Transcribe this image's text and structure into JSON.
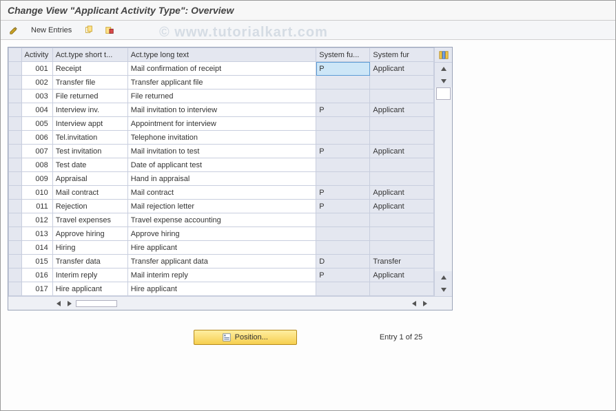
{
  "title": "Change View \"Applicant Activity Type\": Overview",
  "watermark": "© www.tutorialkart.com",
  "toolbar": {
    "new_entries_label": "New Entries"
  },
  "columns": {
    "activity": "Activity",
    "short": "Act.type short t...",
    "long": "Act.type long text",
    "sf1": "System fu...",
    "sf2": "System fur"
  },
  "rows": [
    {
      "act": "001",
      "short": "Receipt",
      "long": "Mail confirmation of receipt",
      "sf1": "P",
      "sf2": "Applicant"
    },
    {
      "act": "002",
      "short": "Transfer file",
      "long": "Transfer applicant file",
      "sf1": "",
      "sf2": ""
    },
    {
      "act": "003",
      "short": "File returned",
      "long": "File returned",
      "sf1": "",
      "sf2": ""
    },
    {
      "act": "004",
      "short": "Interview inv.",
      "long": "Mail invitation to interview",
      "sf1": "P",
      "sf2": "Applicant"
    },
    {
      "act": "005",
      "short": "Interview appt",
      "long": "Appointment for interview",
      "sf1": "",
      "sf2": ""
    },
    {
      "act": "006",
      "short": "Tel.invitation",
      "long": "Telephone invitation",
      "sf1": "",
      "sf2": ""
    },
    {
      "act": "007",
      "short": "Test invitation",
      "long": "Mail invitation to test",
      "sf1": "P",
      "sf2": "Applicant"
    },
    {
      "act": "008",
      "short": "Test date",
      "long": "Date of applicant test",
      "sf1": "",
      "sf2": ""
    },
    {
      "act": "009",
      "short": "Appraisal",
      "long": "Hand in appraisal",
      "sf1": "",
      "sf2": ""
    },
    {
      "act": "010",
      "short": "Mail contract",
      "long": "Mail contract",
      "sf1": "P",
      "sf2": "Applicant"
    },
    {
      "act": "011",
      "short": "Rejection",
      "long": "Mail rejection letter",
      "sf1": "P",
      "sf2": "Applicant"
    },
    {
      "act": "012",
      "short": "Travel expenses",
      "long": "Travel expense accounting",
      "sf1": "",
      "sf2": ""
    },
    {
      "act": "013",
      "short": "Approve hiring",
      "long": "Approve hiring",
      "sf1": "",
      "sf2": ""
    },
    {
      "act": "014",
      "short": "Hiring",
      "long": "Hire applicant",
      "sf1": "",
      "sf2": ""
    },
    {
      "act": "015",
      "short": "Transfer data",
      "long": "Transfer applicant data",
      "sf1": "D",
      "sf2": "Transfer"
    },
    {
      "act": "016",
      "short": "Interim reply",
      "long": "Mail interim reply",
      "sf1": "P",
      "sf2": "Applicant"
    },
    {
      "act": "017",
      "short": "Hire applicant",
      "long": "Hire applicant",
      "sf1": "",
      "sf2": ""
    }
  ],
  "footer": {
    "position_label": "Position...",
    "entry_label": "Entry 1 of 25"
  }
}
